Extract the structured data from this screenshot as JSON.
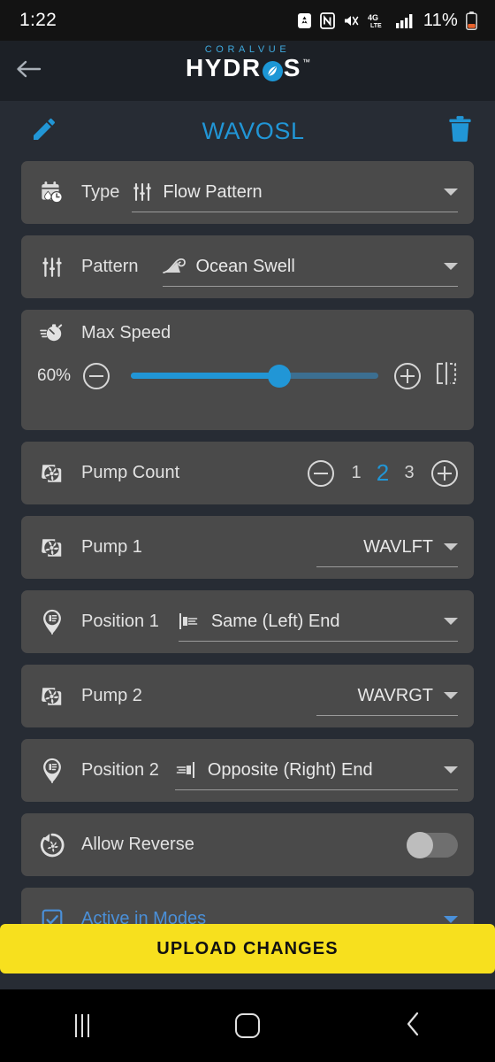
{
  "status_bar": {
    "time": "1:22",
    "battery_percent": "11%",
    "icons": [
      "battery-saver-icon",
      "nfc-icon",
      "mute-vibrate-icon",
      "4g-lte-icon",
      "signal-bars-icon",
      "battery-icon"
    ]
  },
  "app_header": {
    "back_icon": "back-arrow-icon",
    "brand_top": "CORALVUE",
    "brand_left": "HYDR",
    "brand_right": "S",
    "trademark": "™"
  },
  "title_row": {
    "edit_icon": "pencil-icon",
    "title": "WAVOSL",
    "delete_icon": "trash-icon"
  },
  "rows": {
    "type": {
      "icon": "schedule-water-icon",
      "label": "Type",
      "value_icon": "tune-sliders-icon",
      "value": "Flow Pattern"
    },
    "pattern": {
      "icon": "tune-sliders-icon",
      "label": "Pattern",
      "value_icon": "wave-icon",
      "value": "Ocean Swell"
    },
    "max_speed": {
      "icon": "speedometer-icon",
      "label": "Max Speed",
      "percent": "60%",
      "percent_value": 60,
      "minus_icon": "minus-circle-icon",
      "plus_icon": "plus-circle-icon",
      "mirror_icon": "mirror-flip-icon"
    },
    "pump_count": {
      "icon": "pump-impeller-icon",
      "label": "Pump Count",
      "minus_icon": "minus-circle-icon",
      "plus_icon": "plus-circle-icon",
      "options": [
        "1",
        "2",
        "3"
      ],
      "selected": "2"
    },
    "pump_1": {
      "icon": "pump-impeller-icon",
      "label": "Pump 1",
      "value": "WAVLFT"
    },
    "position_1": {
      "icon": "location-pin-icon",
      "label": "Position 1",
      "value_icon": "align-left-end-icon",
      "value": "Same (Left) End"
    },
    "pump_2": {
      "icon": "pump-impeller-icon",
      "label": "Pump 2",
      "value": "WAVRGT"
    },
    "position_2": {
      "icon": "location-pin-icon",
      "label": "Position 2",
      "value_icon": "align-right-end-icon",
      "value": "Opposite (Right) End"
    },
    "allow_reverse": {
      "icon": "reverse-rotation-icon",
      "label": "Allow Reverse",
      "toggle_state": "off"
    },
    "active_in_modes": {
      "icon": "checkbox-icon",
      "label": "Active in Modes"
    }
  },
  "upload_button": {
    "label": "UPLOAD CHANGES"
  },
  "nav_bar": {
    "recents_icon": "recents-icon",
    "home_icon": "home-icon",
    "back_icon": "back-chevron-icon"
  },
  "colors": {
    "accent": "#2196d6",
    "page_bg": "#272c34",
    "card_bg": "#4a4a4a",
    "upload_yellow": "#f7e01e",
    "brand_cyan": "#3fa9dd"
  }
}
